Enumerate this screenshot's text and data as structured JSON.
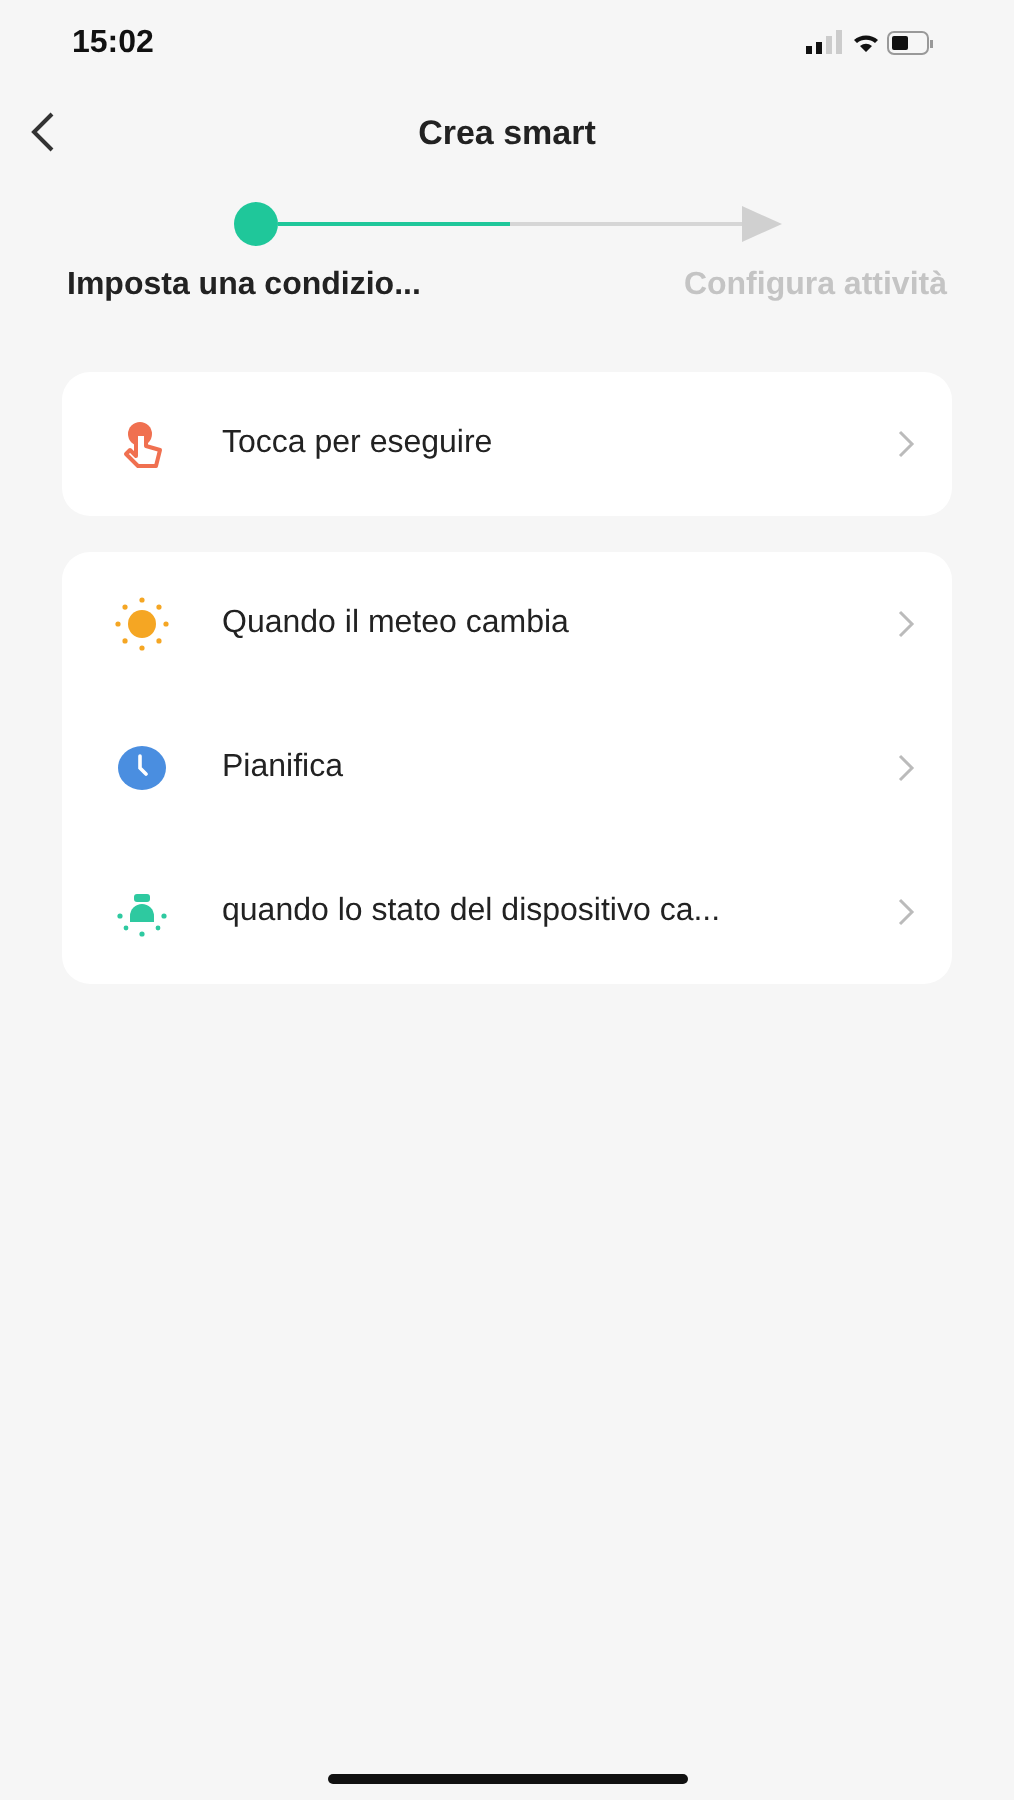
{
  "status_bar": {
    "time": "15:02"
  },
  "header": {
    "title": "Crea smart"
  },
  "progress": {
    "level": 0.5
  },
  "steps": [
    {
      "label": "Imposta una condizio...",
      "selected": true
    },
    {
      "label": "Configura attività",
      "selected": false
    }
  ],
  "groups": [
    {
      "items": [
        {
          "kind": "tap",
          "label": "Tocca per eseguire"
        }
      ]
    },
    {
      "items": [
        {
          "kind": "weather",
          "label": "Quando il meteo cambia"
        },
        {
          "kind": "schedule",
          "label": "Pianifica"
        },
        {
          "kind": "device",
          "label": "quando lo stato del dispositivo ca..."
        }
      ]
    }
  ]
}
